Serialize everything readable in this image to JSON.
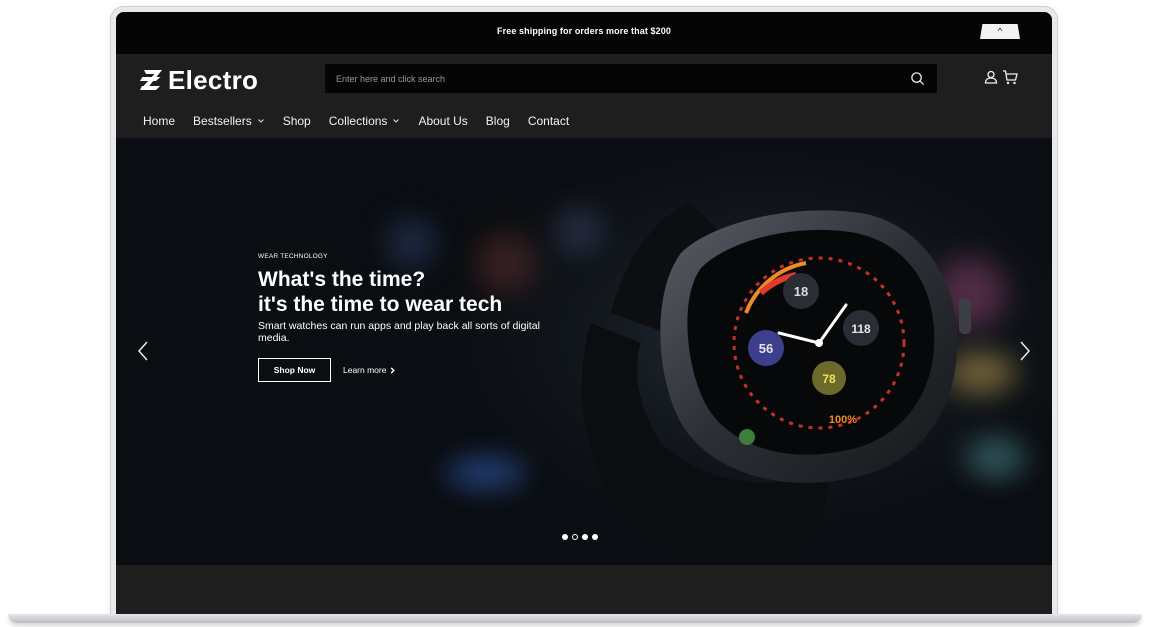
{
  "topbar": {
    "announcement": "Free shipping for orders more that $200",
    "collapse_symbol": "^"
  },
  "brand": {
    "name": "Electro"
  },
  "search": {
    "placeholder": "Enter here and click search",
    "icon": "search-icon"
  },
  "header_icons": [
    "user-icon",
    "cart-icon"
  ],
  "nav": {
    "items": [
      {
        "label": "Home",
        "dropdown": false
      },
      {
        "label": "Bestsellers",
        "dropdown": true
      },
      {
        "label": "Shop",
        "dropdown": false
      },
      {
        "label": "Collections",
        "dropdown": true
      },
      {
        "label": "About Us",
        "dropdown": false
      },
      {
        "label": "Blog",
        "dropdown": false
      },
      {
        "label": "Contact",
        "dropdown": false
      }
    ]
  },
  "hero": {
    "eyebrow": "WEAR TECHNOLOGY",
    "headline_line1": "What's the time?",
    "headline_line2": "it's the time to wear tech",
    "subline": "Smart watches can run apps and play back all sorts of digital media.",
    "primary_cta": "Shop Now",
    "secondary_cta": "Learn more",
    "secondary_cta_icon": "chevron-right-icon",
    "slide_count": 4,
    "active_slide": 2
  },
  "watch_face": {
    "complications": [
      "18",
      "56",
      "118",
      "78"
    ],
    "ring_text": "100%"
  },
  "colors": {
    "topbar": "#050505",
    "header": "#1e1e1e",
    "accent_red": "#e23b2e",
    "accent_orange": "#f08a24"
  }
}
